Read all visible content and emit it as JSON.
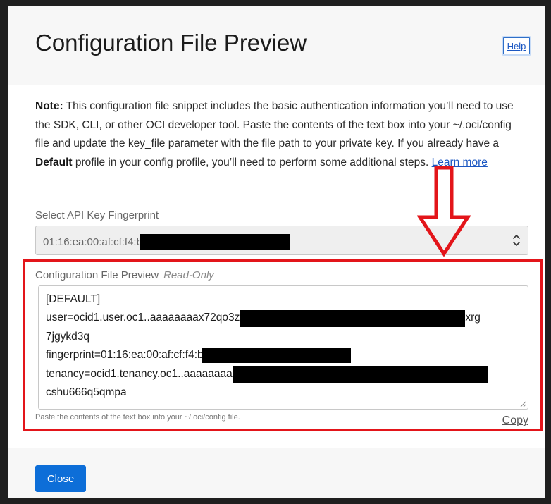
{
  "dialog": {
    "title": "Configuration File Preview",
    "help_label": "Help"
  },
  "note": {
    "bold_prefix": "Note:",
    "text_1": " This configuration file snippet includes the basic authentication information you’ll need to use the SDK, CLI, or other OCI developer tool. Paste the contents of the text box into your ~/.oci/config file and update the key_file parameter with the file path to your private key. If you already have a ",
    "bold_default": "Default",
    "text_2": " profile in your config profile, you’ll need to perform some additional steps. ",
    "learn_more": "Learn more"
  },
  "fingerprint_select": {
    "label": "Select API Key Fingerprint",
    "value_prefix": "01:16:ea:00:af:cf:f4:b"
  },
  "preview": {
    "label": "Configuration File Preview",
    "readonly_label": "Read-Only",
    "lines": {
      "header": "[DEFAULT]",
      "user_prefix": "user=ocid1.user.oc1..aaaaaaaax72qo3z",
      "user_suffix": "xrg",
      "user_wrap": "7jgykd3q",
      "fingerprint_prefix": "fingerprint=01:16:ea:00:af:cf:f4:b",
      "tenancy_prefix": "tenancy=ocid1.tenancy.oc1..aaaaaaaa",
      "tenancy_wrap": "cshu666q5qmpa"
    },
    "hint": "Paste the contents of the text box into your ~/.oci/config file.",
    "copy_label": "Copy"
  },
  "footer": {
    "close_label": "Close"
  },
  "colors": {
    "accent": "#0d6ed8",
    "annotation": "#e3151a",
    "link": "#1b57c2"
  },
  "icons": [
    "chevron-updown-icon",
    "resize-grip-icon",
    "down-arrow-annotation"
  ]
}
